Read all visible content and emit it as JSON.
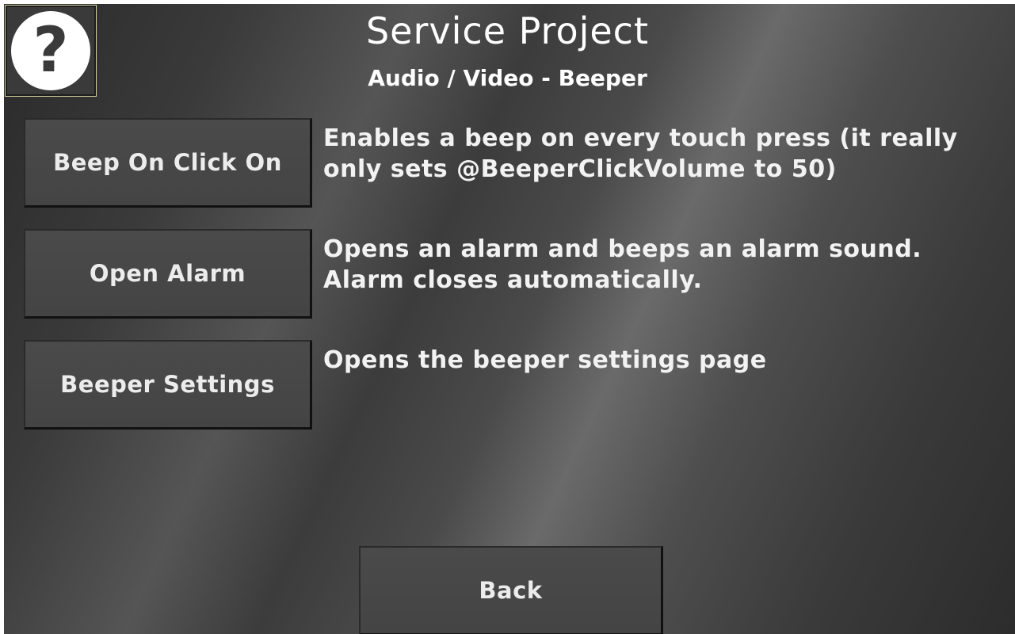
{
  "header": {
    "title": "Service Project",
    "subtitle": "Audio / Video - Beeper",
    "help_glyph": "?",
    "help_icon": "question-mark-icon"
  },
  "actions": [
    {
      "label": "Beep On Click On",
      "description": "Enables a beep on every touch press (it really only sets @BeeperClickVolume to 50)"
    },
    {
      "label": "Open Alarm",
      "description": "Opens an alarm and beeps an alarm sound. Alarm closes automatically."
    },
    {
      "label": "Beeper Settings",
      "description": "Opens the beeper settings page"
    }
  ],
  "footer": {
    "back_label": "Back"
  },
  "colors": {
    "background": "#4a4a4a",
    "button": "#464646",
    "text": "#f2f2f2",
    "help_border": "#d8d4a0"
  }
}
